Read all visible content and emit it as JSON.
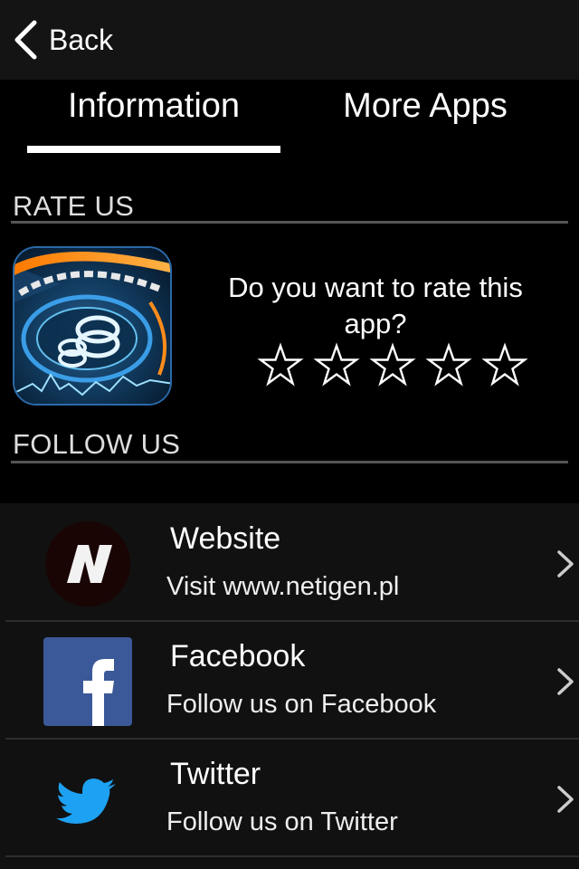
{
  "navbar": {
    "back_label": "Back"
  },
  "tabs": [
    {
      "label": "Information",
      "selected": true
    },
    {
      "label": "More Apps",
      "selected": false
    }
  ],
  "rate": {
    "section_title": "RATE US",
    "prompt": "Do you want to rate this app?",
    "stars_total": 5,
    "stars_filled": 0
  },
  "follow": {
    "section_title": "FOLLOW US",
    "items": [
      {
        "title": "Website",
        "subtitle": "Visit www.netigen.pl",
        "icon": "netigen-logo-icon"
      },
      {
        "title": "Facebook",
        "subtitle": "Follow us on Facebook",
        "icon": "facebook-icon"
      },
      {
        "title": "Twitter",
        "subtitle": "Follow us on Twitter",
        "icon": "twitter-icon"
      }
    ]
  },
  "colors": {
    "background": "#000000",
    "navbar": "#141414",
    "list_background": "#111111",
    "facebook_blue": "#3b5998",
    "twitter_blue": "#1da1f2"
  }
}
